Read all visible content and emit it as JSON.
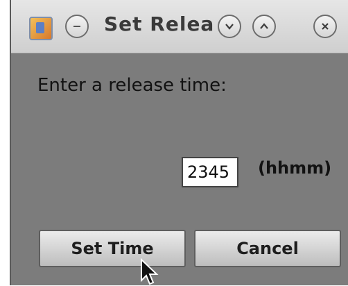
{
  "window": {
    "title": "Set Relea",
    "icons": [
      "java-app-icon",
      "window-menu-icon",
      "minimize-icon",
      "maximize-icon",
      "close-icon"
    ]
  },
  "dialog": {
    "prompt": "Enter a release time:",
    "time_value": "2345",
    "format_hint": "(hhmm)",
    "set_time_label": "Set Time",
    "cancel_label": "Cancel"
  },
  "colors": {
    "dialog_background": "#7c7c7c",
    "title_bar": "#dadada"
  }
}
